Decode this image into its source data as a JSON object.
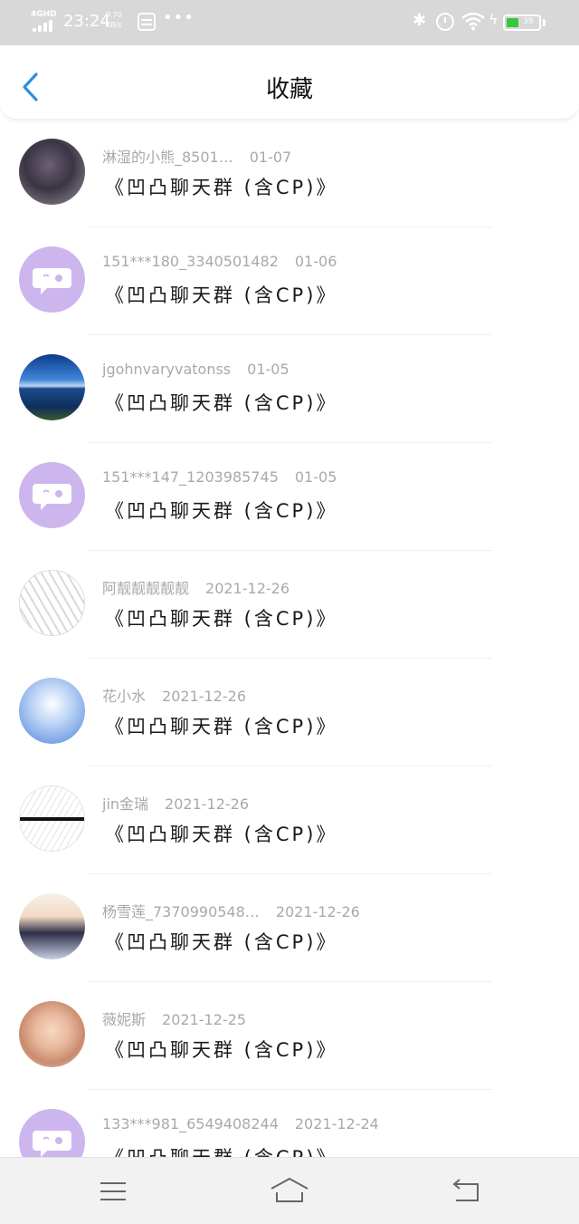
{
  "status_bar": {
    "network": "4GHD",
    "time": "23:24",
    "speed_value": "9.70",
    "speed_unit": "KB/s",
    "more": "•••",
    "battery_level": "39",
    "battery_fraction": 0.39,
    "battery_color": "#35c83c"
  },
  "header": {
    "title": "收藏",
    "back_icon": "chevron-left-icon",
    "accent_color": "#2f8fe0"
  },
  "favorites": [
    {
      "sender": "淋湿的小熊_8501…",
      "date": "01-07",
      "message": "《凹凸聊天群 (含CP)》"
    },
    {
      "sender": "151***180_3340501482",
      "date": "01-06",
      "message": "《凹凸聊天群 (含CP)》"
    },
    {
      "sender": "jgohnvaryvatonss",
      "date": "01-05",
      "message": "《凹凸聊天群 (含CP)》"
    },
    {
      "sender": "151***147_1203985745",
      "date": "01-05",
      "message": "《凹凸聊天群 (含CP)》"
    },
    {
      "sender": "阿靓靓靓靓靓",
      "date": "2021-12-26",
      "message": "《凹凸聊天群 (含CP)》"
    },
    {
      "sender": "花小水",
      "date": "2021-12-26",
      "message": "《凹凸聊天群 (含CP)》"
    },
    {
      "sender": "jin金瑞",
      "date": "2021-12-26",
      "message": "《凹凸聊天群 (含CP)》"
    },
    {
      "sender": "杨雪莲_7370990548…",
      "date": "2021-12-26",
      "message": "《凹凸聊天群 (含CP)》"
    },
    {
      "sender": "薇妮斯",
      "date": "2021-12-25",
      "message": "《凹凸聊天群 (含CP)》"
    },
    {
      "sender": "133***981_6549408244",
      "date": "2021-12-24",
      "message": "《凹凸聊天群 (含CP)》"
    }
  ],
  "bottom_nav": {
    "menu_icon": "menu-icon",
    "home_icon": "home-icon",
    "back_icon": "return-icon"
  }
}
